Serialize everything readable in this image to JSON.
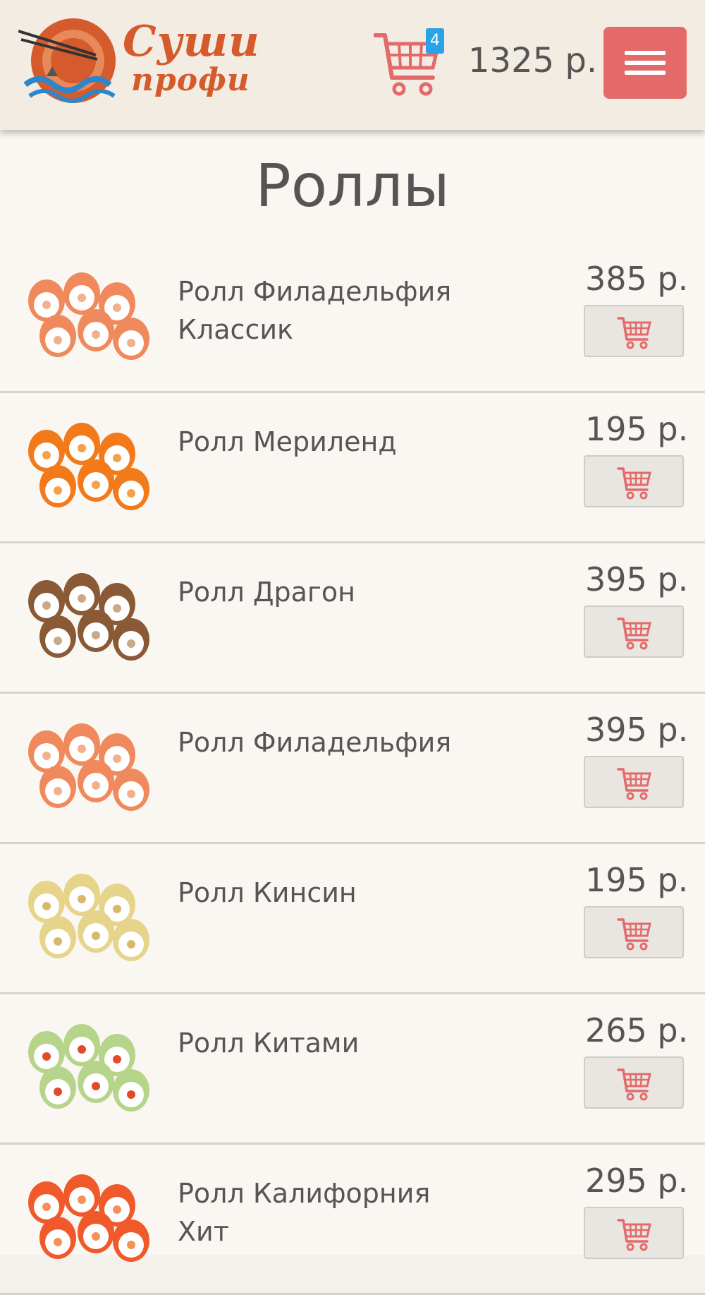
{
  "header": {
    "logo_line1": "Суши",
    "logo_line2": "профи",
    "cart_count": "4",
    "cart_total": "1325 р.",
    "menu_icon": "hamburger-icon",
    "cart_icon": "cart-icon"
  },
  "colors": {
    "accent": "#e46a6a",
    "badge": "#2aa3e6",
    "logo": "#d55a2c"
  },
  "page": {
    "title": "Роллы"
  },
  "items": [
    {
      "name": "Ролл Филадельфия Классик",
      "price": "385 р.",
      "thumb": "salmon-roll"
    },
    {
      "name": "Ролл Мериленд",
      "price": "195 р.",
      "thumb": "orange-roe-roll"
    },
    {
      "name": "Ролл Драгон",
      "price": "395 р.",
      "thumb": "eel-roll"
    },
    {
      "name": "Ролл Филадельфия",
      "price": "395 р.",
      "thumb": "salmon-roll"
    },
    {
      "name": "Ролл Кинсин",
      "price": "195 р.",
      "thumb": "omelette-roll"
    },
    {
      "name": "Ролл Китами",
      "price": "265 р.",
      "thumb": "cucumber-roll"
    },
    {
      "name": "Ролл Калифорния Хит",
      "price": "295 р.",
      "thumb": "roe-roll"
    }
  ]
}
